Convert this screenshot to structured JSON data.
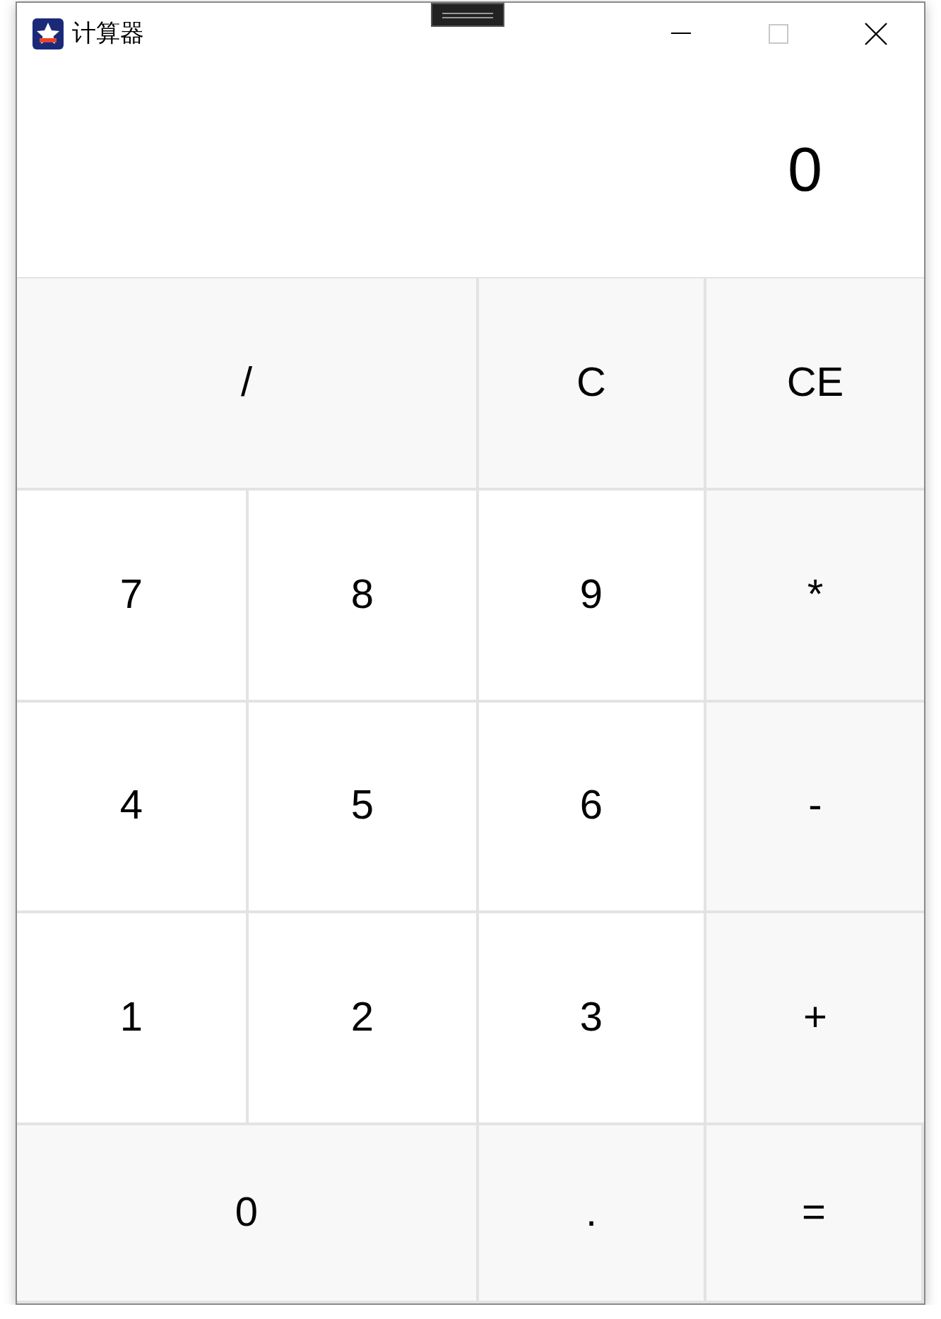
{
  "window": {
    "title": "计算器"
  },
  "display": {
    "value": "0"
  },
  "buttons": [
    {
      "label": "/",
      "kind": "operator",
      "wide": true
    },
    {
      "label": "C",
      "kind": "operator",
      "wide": false
    },
    {
      "label": "CE",
      "kind": "operator",
      "wide": false
    },
    {
      "label": "7",
      "kind": "digit",
      "wide": false
    },
    {
      "label": "8",
      "kind": "digit",
      "wide": false
    },
    {
      "label": "9",
      "kind": "digit",
      "wide": false
    },
    {
      "label": "*",
      "kind": "operator",
      "wide": false
    },
    {
      "label": "4",
      "kind": "digit",
      "wide": false
    },
    {
      "label": "5",
      "kind": "digit",
      "wide": false
    },
    {
      "label": "6",
      "kind": "digit",
      "wide": false
    },
    {
      "label": "-",
      "kind": "operator",
      "wide": false
    },
    {
      "label": "1",
      "kind": "digit",
      "wide": false
    },
    {
      "label": "2",
      "kind": "digit",
      "wide": false
    },
    {
      "label": "3",
      "kind": "digit",
      "wide": false
    },
    {
      "label": "+",
      "kind": "operator",
      "wide": false
    },
    {
      "label": "0",
      "kind": "operator",
      "wide": true
    },
    {
      "label": ".",
      "kind": "operator",
      "wide": false
    },
    {
      "label": "=",
      "kind": "operator",
      "wide": false
    }
  ]
}
